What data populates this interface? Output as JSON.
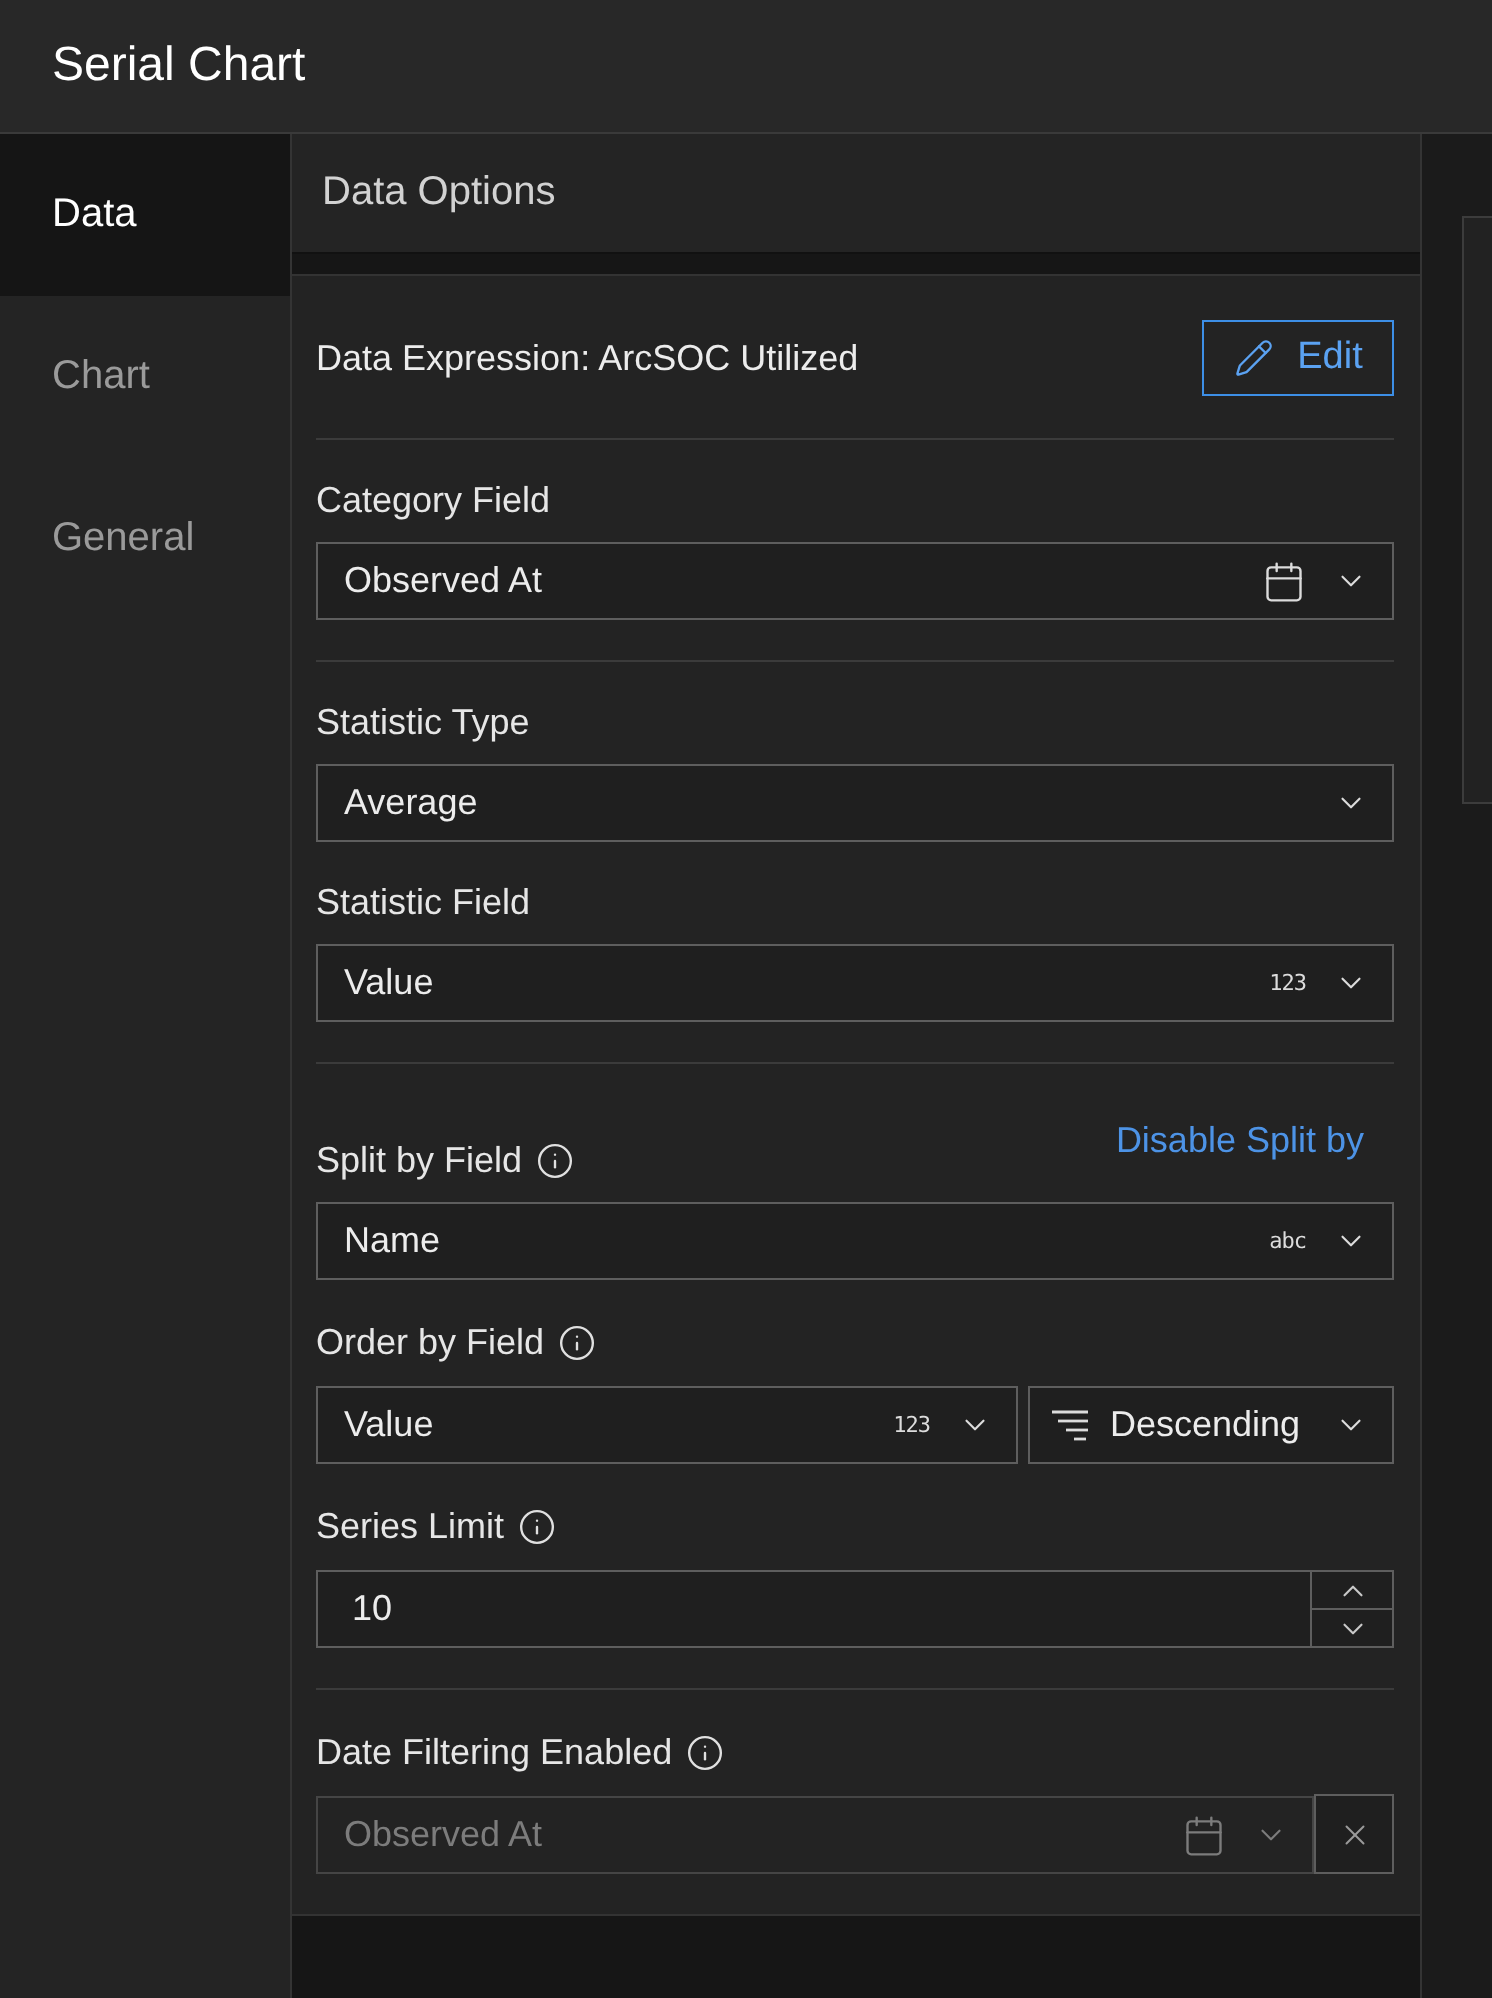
{
  "window": {
    "title": "Serial Chart"
  },
  "sidebar": {
    "items": [
      {
        "label": "Data",
        "selected": true
      },
      {
        "label": "Chart",
        "selected": false
      },
      {
        "label": "General",
        "selected": false
      }
    ]
  },
  "panel": {
    "title": "Data Options",
    "sections": [
      {
        "kind": "expression",
        "text": "Data Expression: ArcSOC Utilized",
        "button": "Edit"
      },
      {
        "kind": "fields",
        "fields": [
          {
            "kind": "date_select",
            "label": "Category Field",
            "info": false,
            "value": "Observed At",
            "disabled": false,
            "clear_button": false
          }
        ]
      },
      {
        "kind": "fields",
        "fields": [
          {
            "kind": "select",
            "label": "Statistic Type",
            "info": false,
            "value": "Average",
            "disabled": false,
            "clear_button": false
          },
          {
            "kind": "select",
            "label": "Statistic Field",
            "info": false,
            "value": "Value",
            "badge": "123",
            "disabled": false,
            "clear_button": false
          }
        ]
      },
      {
        "kind": "fields",
        "fields": [
          {
            "kind": "select",
            "label": "Split by Field",
            "info": true,
            "action": "Disable Split by",
            "value": "Name",
            "badge": "abc",
            "disabled": false,
            "clear_button": false
          },
          {
            "kind": "pair",
            "label": "Order by Field",
            "info": true,
            "selects": [
              {
                "kind": "select",
                "value": "Value",
                "badge": "123"
              },
              {
                "kind": "sort_select",
                "value": "Descending"
              }
            ]
          },
          {
            "kind": "number",
            "label": "Series Limit",
            "info": true,
            "value": "10"
          }
        ]
      },
      {
        "kind": "fields",
        "fields": [
          {
            "kind": "date_select",
            "label": "Date Filtering Enabled",
            "info": true,
            "value": "Observed At",
            "disabled": true,
            "clear_button": true
          }
        ]
      }
    ]
  }
}
